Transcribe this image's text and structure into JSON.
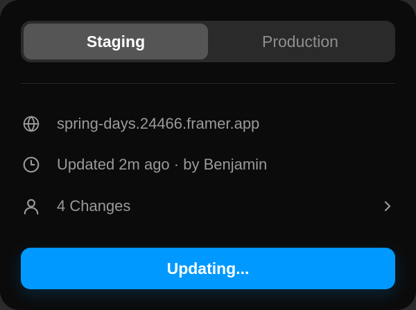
{
  "tabs": [
    {
      "label": "Staging",
      "active": true
    },
    {
      "label": "Production",
      "active": false
    }
  ],
  "info": {
    "url": {
      "icon": "globe-icon",
      "text": "spring-days.24466.framer.app"
    },
    "updated": {
      "icon": "clock-icon",
      "text": "Updated 2m ago · by Benjamin"
    },
    "changes": {
      "icon": "user-icon",
      "text": "4 Changes",
      "chevron": "chevron-right-icon"
    }
  },
  "action": {
    "label": "Updating..."
  },
  "colors": {
    "panel_bg": "#0b0b0b",
    "segment_bg": "#2a2a2a",
    "segment_active": "#555555",
    "accent": "#0099ff",
    "muted_text": "#9a9a9a"
  }
}
